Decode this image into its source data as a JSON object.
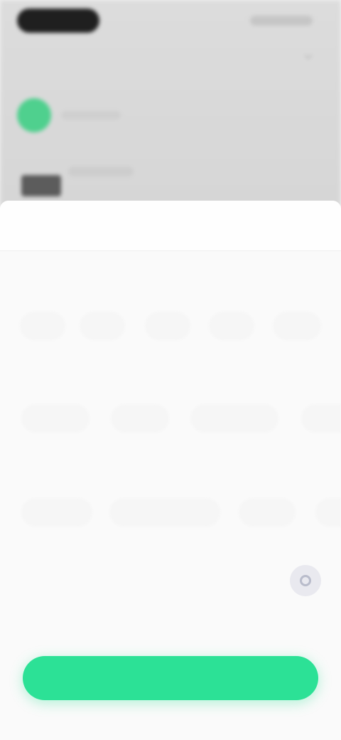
{
  "app": {
    "title": ""
  },
  "sheet": {
    "header": {
      "cancel_label": "",
      "title": "",
      "reset_label": ""
    },
    "sections": [
      {
        "title": "",
        "chips": [
          "",
          "",
          "",
          "",
          ""
        ]
      },
      {
        "title": "",
        "chips": [
          "",
          "",
          "",
          ""
        ]
      },
      {
        "title": "",
        "chips": [
          "",
          "",
          "",
          ""
        ]
      }
    ],
    "toggle": {
      "title": "",
      "description": "",
      "enabled": false
    },
    "apply_label": ""
  },
  "colors": {
    "accent": "#2ce196",
    "reset": "#ffb27c",
    "avatar": "#4fd08e"
  },
  "icons": {
    "header_right": "chevron-down-icon",
    "toggle": "radio-icon"
  }
}
